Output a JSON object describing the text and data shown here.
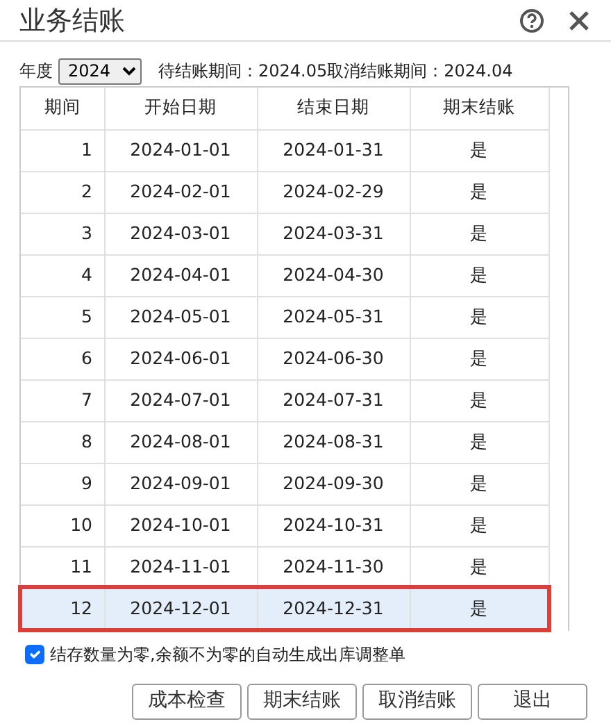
{
  "window": {
    "title": "业务结账"
  },
  "filter": {
    "year_label": "年度",
    "year": "2024",
    "pending_label": "待结账期间：",
    "pending": "2024.05",
    "cancel_label": "取消结账期间：",
    "cancel": "2024.04"
  },
  "table": {
    "columns": [
      "期间",
      "开始日期",
      "结束日期",
      "期末结账"
    ],
    "rows": [
      {
        "cells": [
          "1",
          "2024-01-01",
          "2024-01-31",
          "是"
        ],
        "selected": false
      },
      {
        "cells": [
          "2",
          "2024-02-01",
          "2024-02-29",
          "是"
        ],
        "selected": false
      },
      {
        "cells": [
          "3",
          "2024-03-01",
          "2024-03-31",
          "是"
        ],
        "selected": false
      },
      {
        "cells": [
          "4",
          "2024-04-01",
          "2024-04-30",
          "是"
        ],
        "selected": false
      },
      {
        "cells": [
          "5",
          "2024-05-01",
          "2024-05-31",
          "是"
        ],
        "selected": false
      },
      {
        "cells": [
          "6",
          "2024-06-01",
          "2024-06-30",
          "是"
        ],
        "selected": false
      },
      {
        "cells": [
          "7",
          "2024-07-01",
          "2024-07-31",
          "是"
        ],
        "selected": false
      },
      {
        "cells": [
          "8",
          "2024-08-01",
          "2024-08-31",
          "是"
        ],
        "selected": false
      },
      {
        "cells": [
          "9",
          "2024-09-01",
          "2024-09-30",
          "是"
        ],
        "selected": false
      },
      {
        "cells": [
          "10",
          "2024-10-01",
          "2024-10-31",
          "是"
        ],
        "selected": false
      },
      {
        "cells": [
          "11",
          "2024-11-01",
          "2024-11-30",
          "是"
        ],
        "selected": false
      },
      {
        "cells": [
          "12",
          "2024-12-01",
          "2024-12-31",
          "是"
        ],
        "selected": true
      }
    ]
  },
  "option": {
    "label": "结存数量为零,余额不为零的自动生成出库调整单",
    "checked": true
  },
  "buttons": [
    "成本检查",
    "期末结账",
    "取消结账",
    "退出"
  ]
}
